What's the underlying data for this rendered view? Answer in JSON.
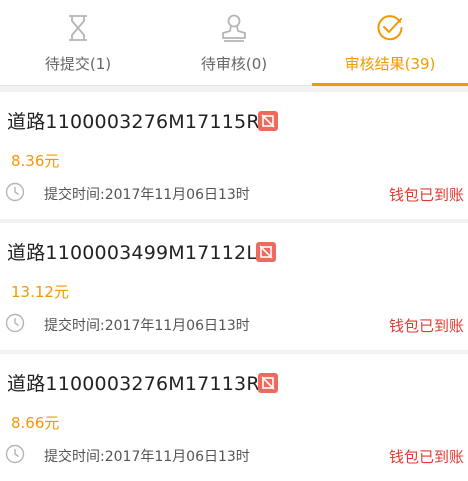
{
  "tabs": [
    {
      "label": "待提交(1)",
      "icon": "hourglass-icon",
      "active": false
    },
    {
      "label": "待审核(0)",
      "icon": "stamp-icon",
      "active": false
    },
    {
      "label": "审核结果(39)",
      "icon": "check-circle-icon",
      "active": true
    }
  ],
  "records": [
    {
      "title": "道路1100003276M17115R",
      "amount": "8.36元",
      "time": "提交时间:2017年11月06日13时",
      "status": "钱包已到账"
    },
    {
      "title": "道路1100003499M17112L",
      "amount": "13.12元",
      "time": "提交时间:2017年11月06日13时",
      "status": "钱包已到账"
    },
    {
      "title": "道路1100003276M17113R",
      "amount": "8.66元",
      "time": "提交时间:2017年11月06日13时",
      "status": "钱包已到账"
    }
  ],
  "colors": {
    "accent": "#f39800",
    "status": "#e03c31",
    "badge": "#ee6a5c",
    "muted_icon": "#b5b5b5"
  }
}
